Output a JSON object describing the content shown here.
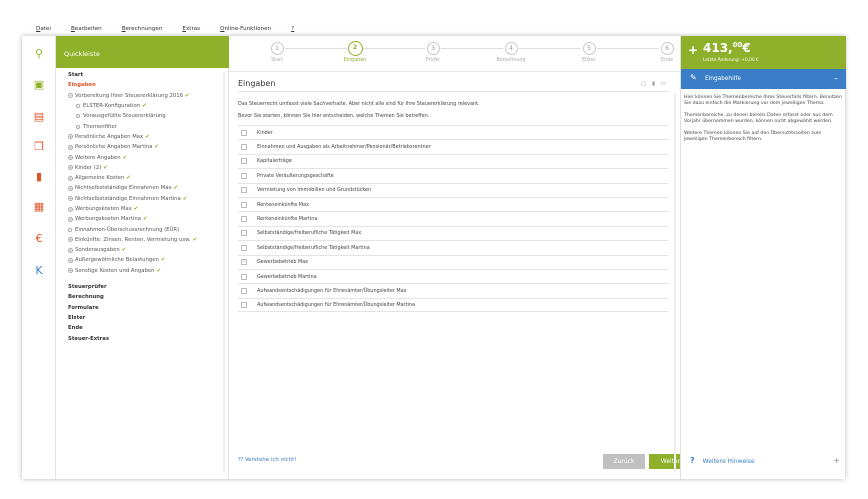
{
  "menubar": [
    {
      "first": "D",
      "rest": "atei"
    },
    {
      "first": "B",
      "rest": "earbeiten"
    },
    {
      "first": "B",
      "rest": "erechnungen"
    },
    {
      "first": "E",
      "rest": "xtras"
    },
    {
      "first": "O",
      "rest": "nline-Funktionen"
    },
    {
      "first": "?",
      "rest": ""
    }
  ],
  "iconbar": [
    {
      "name": "search-icon",
      "glyph": "⚲",
      "color": "#8fb02a"
    },
    {
      "name": "chat-icon",
      "glyph": "▣",
      "color": "#8fb02a"
    },
    {
      "name": "document-icon",
      "glyph": "▤",
      "color": "#e0552a"
    },
    {
      "name": "folders-icon",
      "glyph": "❐",
      "color": "#e0552a"
    },
    {
      "name": "chart-icon",
      "glyph": "▮",
      "color": "#e0552a"
    },
    {
      "name": "calculator-icon",
      "glyph": "▦",
      "color": "#e0552a"
    },
    {
      "name": "euro-icon",
      "glyph": "€",
      "color": "#e0552a"
    },
    {
      "name": "k-icon",
      "glyph": "K",
      "color": "#3b7ec8"
    }
  ],
  "nav": {
    "quick": "Quickleiste",
    "tree": [
      {
        "label": "Start",
        "type": "bold",
        "indent": 12
      },
      {
        "label": "Eingaben",
        "type": "active",
        "indent": 12
      },
      {
        "label": "Vorbereitung Ihrer Steuererklärung 2016",
        "type": "pm",
        "indent": 12,
        "check": true,
        "sign": "−"
      },
      {
        "label": "ELSTER-Konfiguration",
        "type": "cir",
        "indent": 20,
        "check": true
      },
      {
        "label": "Vorausgefüllte Steuererklärung",
        "type": "cir",
        "indent": 20,
        "check": false
      },
      {
        "label": "Themenfilter",
        "type": "cir",
        "indent": 20,
        "check": false
      },
      {
        "label": "Persönliche Angaben Max",
        "type": "pm",
        "indent": 12,
        "check": true,
        "sign": "+"
      },
      {
        "label": "Persönliche Angaben Martina",
        "type": "pm",
        "indent": 12,
        "check": true,
        "sign": "+"
      },
      {
        "label": "Weitere Angaben",
        "type": "pm",
        "indent": 12,
        "check": true,
        "sign": "+"
      },
      {
        "label": "Kinder (2)",
        "type": "pm",
        "indent": 12,
        "check": true,
        "sign": "+"
      },
      {
        "label": "Allgemeine Kosten",
        "type": "pm",
        "indent": 12,
        "check": true,
        "sign": "+"
      },
      {
        "label": "Nichtselbstständige Einnahmen Max",
        "type": "pm",
        "indent": 12,
        "check": true,
        "sign": "+"
      },
      {
        "label": "Nichtselbstständige Einnahmen Martina",
        "type": "pm",
        "indent": 12,
        "check": true,
        "sign": "+"
      },
      {
        "label": "Werbungskosten Max",
        "type": "pm",
        "indent": 12,
        "check": true,
        "sign": "+"
      },
      {
        "label": "Werbungskosten Martina",
        "type": "pm",
        "indent": 12,
        "check": true,
        "sign": "+"
      },
      {
        "label": "Einnahmen-Überschussrechnung (EÜR)",
        "type": "cir",
        "indent": 12,
        "check": false
      },
      {
        "label": "Einkünfte: Zinsen, Renten, Vermietung usw.",
        "type": "pm",
        "indent": 12,
        "check": true,
        "sign": "+"
      },
      {
        "label": "Sonderausgaben",
        "type": "pm",
        "indent": 12,
        "check": true,
        "sign": "+"
      },
      {
        "label": "Außergewöhnliche Belastungen",
        "type": "pm",
        "indent": 12,
        "check": true,
        "sign": "+"
      },
      {
        "label": "Sonstige Kosten und Angaben",
        "type": "pm",
        "indent": 12,
        "check": true,
        "sign": "+"
      },
      {
        "label": "",
        "type": "spacer",
        "indent": 12
      },
      {
        "label": "Steuerprüfer",
        "type": "bold",
        "indent": 12
      },
      {
        "label": "Berechnung",
        "type": "bold",
        "indent": 12
      },
      {
        "label": "Formulare",
        "type": "bold",
        "indent": 12
      },
      {
        "label": "Elster",
        "type": "bold",
        "indent": 12
      },
      {
        "label": "Ende",
        "type": "bold",
        "indent": 12
      },
      {
        "label": "Steuer-Extras",
        "type": "bold",
        "indent": 12
      }
    ]
  },
  "steps": [
    {
      "num": "1",
      "label": "Start",
      "active": false
    },
    {
      "num": "2",
      "label": "Eingaben",
      "active": true
    },
    {
      "num": "3",
      "label": "Prüfer",
      "active": false
    },
    {
      "num": "4",
      "label": "Berechnung",
      "active": false
    },
    {
      "num": "5",
      "label": "Elster",
      "active": false
    },
    {
      "num": "6",
      "label": "Ende",
      "active": false
    }
  ],
  "main": {
    "title": "Eingaben",
    "title_icons": "▢ ▮ ▭",
    "intro1": "Das Steuerrecht umfasst viele Sachverhalte. Aber nicht alle sind für Ihre Steuererklärung relevant.",
    "intro2": "Bevor Sie starten, können Sie hier entscheiden, welche Themen Sie betreffen.",
    "items": [
      {
        "label": "Kinder",
        "checked": false
      },
      {
        "label": "Einnahmen und Ausgaben als Arbeitnehmer/Pensionär/Betriebsrentner",
        "checked": false
      },
      {
        "label": "Kapitalerträge",
        "checked": false
      },
      {
        "label": "Private Veräußerungsgeschäfte",
        "checked": false
      },
      {
        "label": "Vermietung von Immobilien und Grundstücken",
        "checked": false
      },
      {
        "label": "Renteneinkünfte Max",
        "checked": false
      },
      {
        "label": "Renteneinkünfte Martina",
        "checked": false
      },
      {
        "label": "Selbstständige/freiberufliche Tätigkeit Max",
        "checked": false
      },
      {
        "label": "Selbstständige/freiberufliche Tätigkeit Martina",
        "checked": false
      },
      {
        "label": "Gewerbebetrieb Max",
        "checked": true
      },
      {
        "label": "Gewerbebetrieb Martina",
        "checked": false
      },
      {
        "label": "Aufwandsentschädigungen für Ehrenämter/Übungsleiter Max",
        "checked": false
      },
      {
        "label": "Aufwandsentschädigungen für Ehrenämter/Übungsleiter Martina",
        "checked": false
      }
    ],
    "verstehe": "⁇ Verstehe ich nicht!",
    "back": "Zurück",
    "next": "Weiter"
  },
  "right": {
    "plus": "+",
    "amount_main": "413,",
    "amount_cents": "00",
    "amount_currency": "€",
    "amount_sub": "Letzte Änderung: +0,00 €",
    "help_title": "Eingabehilfe",
    "help_p1": "Hier können Sie Themenbereiche Ihres Steuerfalls filtern. Benutzen Sie dazu einfach die Markierung vor dem jeweiligen Thema.",
    "help_p2": "Themenbereiche, zu denen bereits Daten erfasst oder aus dem Vorjahr übernommen wurden, können nicht abgewählt werden.",
    "help_p3": "Weitere Themen können Sie auf den Übersichtsseiten zum jeweiligen Themenbereich filtern.",
    "more_help": "Weitere Hinweise"
  },
  "colors": {
    "green": "#8fb02a",
    "blue": "#3b7ec8",
    "orange": "#e0552a"
  }
}
